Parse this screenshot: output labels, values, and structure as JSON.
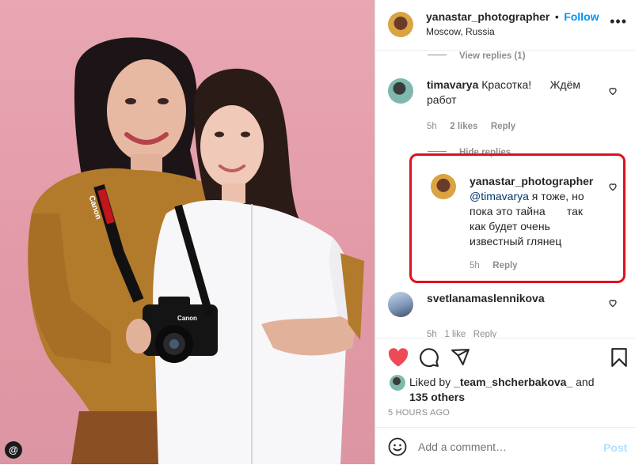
{
  "post": {
    "username": "yanastar_photographer",
    "follow_label": "Follow",
    "location": "Moscow, Russia"
  },
  "photo": {
    "camera_brand": "Canon",
    "camera_badge": "Canon"
  },
  "comments": {
    "view_replies": "View replies (1)",
    "c1": {
      "username": "timavarya",
      "text_line1": "Красотка!      Ждём",
      "text_line2": "работ",
      "time": "5h",
      "likes": "2 likes",
      "reply": "Reply"
    },
    "hide_replies": "Hide replies",
    "reply1": {
      "username": "yanastar_photographer",
      "mention": "@timavarya",
      "text_line1_rest": " я тоже, но",
      "text_line2": "пока это тайна       так",
      "text_line3": "как будет очень",
      "text_line4": "известный глянец",
      "time": "5h",
      "reply": "Reply"
    },
    "c2": {
      "username": "svetlanamaslennikova",
      "meta_partial": "5h   1 like   Reply"
    }
  },
  "actions": {
    "liked_by_prefix": "Liked by",
    "liked_by_user": "_team_shcherbakova_",
    "and": "and",
    "others": "135 others",
    "timestamp": "5 HOURS AGO"
  },
  "add_comment": {
    "placeholder": "Add a comment…",
    "post_label": "Post"
  },
  "icons": {
    "like": "heart-filled-icon",
    "comment": "comment-icon",
    "share": "share-icon",
    "save": "bookmark-icon",
    "emoji": "emoji-icon",
    "more": "more-icon",
    "small_heart": "heart-outline-icon",
    "threads": "threads-icon"
  },
  "colors": {
    "like_red": "#ed4956",
    "follow_blue": "#0095f6",
    "highlight_red": "#e0101e",
    "background_pink": "#e4a1ae"
  }
}
